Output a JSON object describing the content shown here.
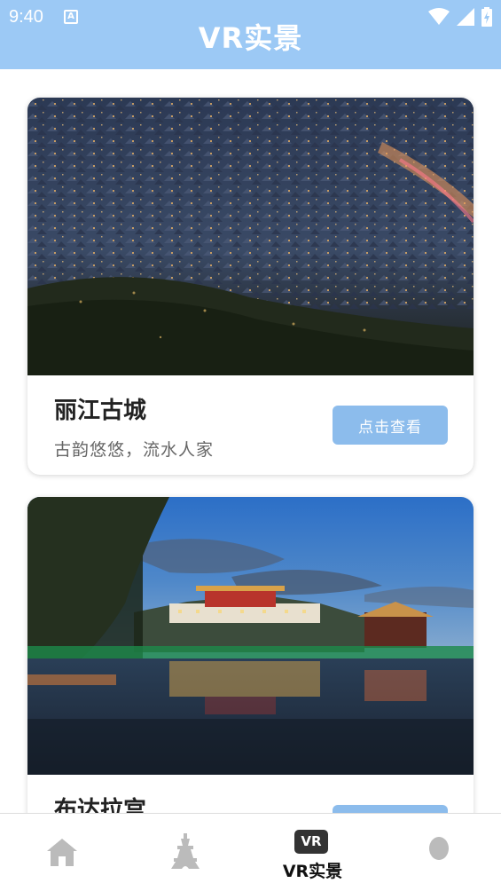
{
  "status_bar": {
    "time": "9:40",
    "notification_icon": "a-letter-icon",
    "icons": [
      "wifi-icon",
      "signal-icon",
      "battery-icon"
    ]
  },
  "header": {
    "title": "VR实景",
    "background_color": "#9cc9f5"
  },
  "cards": [
    {
      "title": "丽江古城",
      "subtitle": "古韵悠悠，流水人家",
      "button_label": "点击查看",
      "image": "night-aerial-old-town-photo"
    },
    {
      "title": "布达拉宫",
      "subtitle": "",
      "button_label": "",
      "image": "potala-palace-night-reflection-photo"
    }
  ],
  "bottom_nav": {
    "items": [
      {
        "icon": "home-icon",
        "label": ""
      },
      {
        "icon": "tower-icon",
        "label": ""
      },
      {
        "icon": "vr-icon",
        "badge": "VR",
        "label": "VR实景",
        "active": true
      },
      {
        "icon": "profile-icon",
        "label": ""
      }
    ]
  },
  "colors": {
    "accent": "#9cc9f5",
    "button": "#8cbcec",
    "inactive_icon": "#bbbbbb"
  }
}
